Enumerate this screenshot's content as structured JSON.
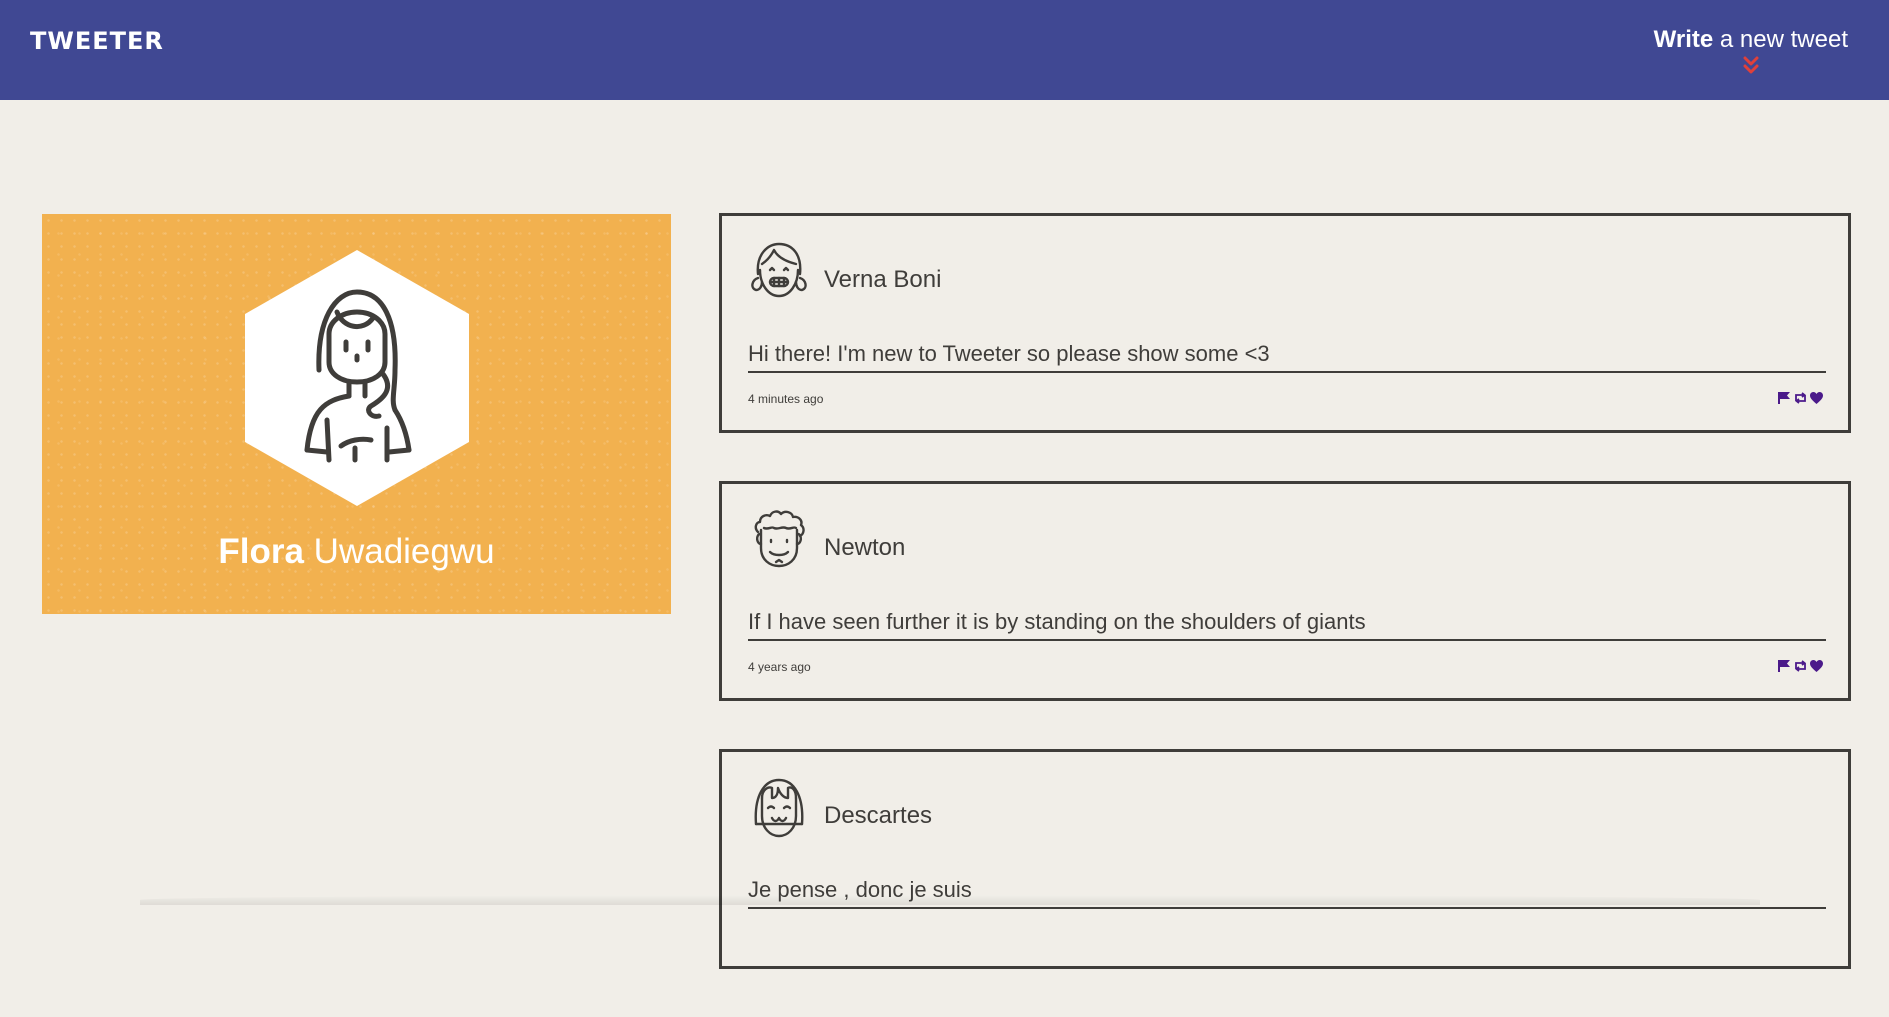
{
  "nav": {
    "brand": "TWEETER",
    "compose_bold": "Write",
    "compose_rest": " a new tweet",
    "compose_icon": "double-chevron-down-icon",
    "colors": {
      "background": "#404893",
      "chevron": "#e0403a"
    }
  },
  "profile": {
    "first_name": "Flora",
    "last_name": " Uwadiegwu",
    "avatar_icon": "girl-avatar-icon",
    "background_color": "#f2b14f"
  },
  "tweets": [
    {
      "author": "Verna Boni",
      "avatar_icon": "grinning-girl-avatar-icon",
      "text": "Hi there! I'm new to Tweeter so please show some <3",
      "time": "4 minutes ago"
    },
    {
      "author": "Newton",
      "avatar_icon": "curly-haired-man-avatar-icon",
      "text": "If I have seen further it is by standing on the shoulders of giants",
      "time": "4 years ago"
    },
    {
      "author": "Descartes",
      "avatar_icon": "bob-haired-avatar-icon",
      "text": "Je pense , donc je suis",
      "time": ""
    }
  ],
  "actions": {
    "icons": [
      "flag-icon",
      "retweet-icon",
      "heart-icon"
    ],
    "color": "#4b1a8a"
  },
  "colors": {
    "page_background": "#f1eee8",
    "text": "#3f3d3a"
  }
}
